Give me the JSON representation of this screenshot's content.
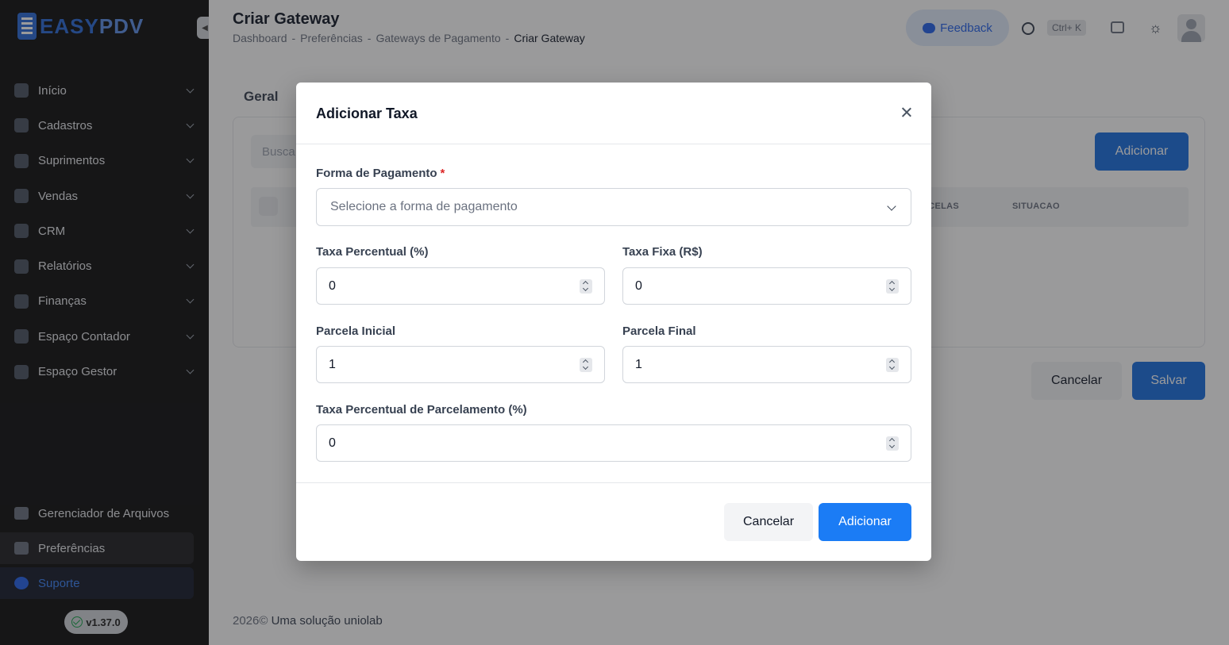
{
  "app": {
    "logo_text_easy": "EASY",
    "logo_text_pdv": "PDV",
    "version": "v1.37.0"
  },
  "sidebar": {
    "items": [
      {
        "label": "Início"
      },
      {
        "label": "Cadastros"
      },
      {
        "label": "Suprimentos"
      },
      {
        "label": "Vendas"
      },
      {
        "label": "CRM"
      },
      {
        "label": "Relatórios"
      },
      {
        "label": "Finanças"
      },
      {
        "label": "Espaço Contador"
      },
      {
        "label": "Espaço Gestor"
      }
    ],
    "bottom": [
      {
        "label": "Gerenciador de Arquivos"
      },
      {
        "label": "Preferências"
      },
      {
        "label": "Suporte"
      }
    ]
  },
  "header": {
    "title": "Criar Gateway",
    "breadcrumb": [
      "Dashboard",
      "-",
      "Preferências",
      "-",
      "Gateways de Pagamento",
      "-",
      "Criar Gateway"
    ],
    "feedback_label": "Feedback",
    "shortcut": "Ctrl+ K"
  },
  "page": {
    "tab_label": "Geral",
    "search_placeholder": "Busca",
    "add_label": "Adicionar",
    "columns": [
      "RCELAS",
      "SITUACAO"
    ],
    "cancel_label": "Cancelar",
    "save_label": "Salvar"
  },
  "footer": {
    "year": "2026©",
    "text": "Uma solução uniolab"
  },
  "modal": {
    "title": "Adicionar Taxa",
    "payment_method_label": "Forma de Pagamento",
    "required_mark": "*",
    "payment_method_placeholder": "Selecione a forma de pagamento",
    "percent_fee_label": "Taxa Percentual (%)",
    "percent_fee_value": "0",
    "fixed_fee_label": "Taxa Fixa (R$)",
    "fixed_fee_value": "0",
    "initial_installment_label": "Parcela Inicial",
    "initial_installment_value": "1",
    "final_installment_label": "Parcela Final",
    "final_installment_value": "1",
    "installment_fee_label": "Taxa Percentual de Parcelamento (%)",
    "installment_fee_value": "0",
    "cancel_label": "Cancelar",
    "add_label": "Adicionar"
  },
  "colors": {
    "primary": "#1b7cf5",
    "sidebar_bg": "#0f0f10",
    "required": "#dc2626"
  }
}
